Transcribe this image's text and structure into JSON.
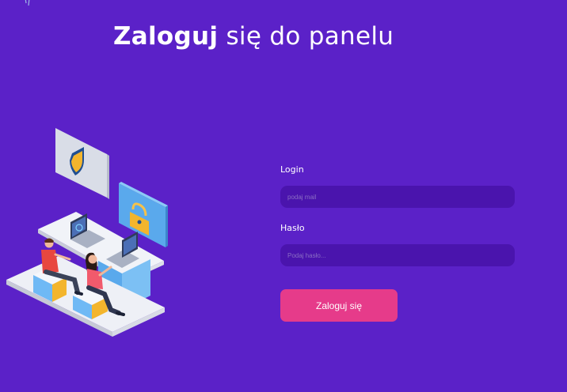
{
  "header": {
    "title_bold": "Zaloguj",
    "title_rest": " się do panelu"
  },
  "login_form": {
    "login_label": "Login",
    "login_placeholder": "podaj mail",
    "login_value": "",
    "password_label": "Hasło",
    "password_placeholder": "Podaj hasło...",
    "password_value": "",
    "submit_label": "Zaloguj się"
  },
  "illustration": {
    "name": "security-workspace-illustration",
    "icons": [
      "shield-icon",
      "padlock-icon",
      "laptop-icon"
    ]
  },
  "colors": {
    "background": "#5b21c8",
    "input_background": "#4a14ad",
    "button": "#e63b8a",
    "text": "#ffffff"
  }
}
